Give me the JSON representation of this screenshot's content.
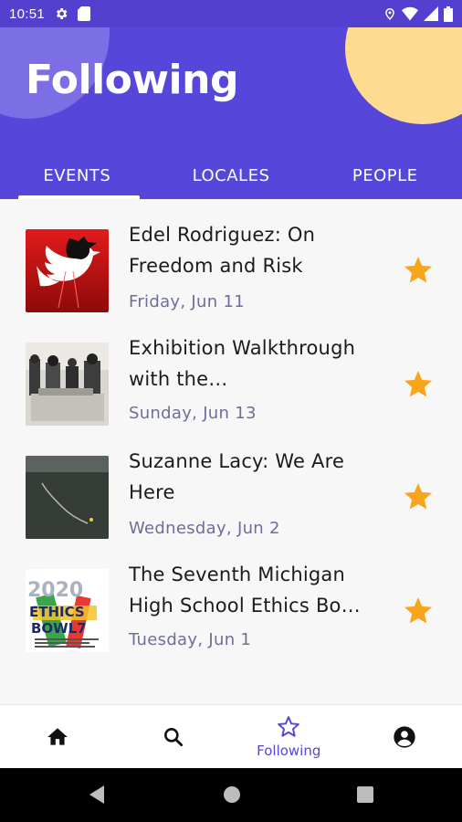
{
  "status_bar": {
    "time": "10:51",
    "icons": [
      "settings-icon",
      "sim-card-icon",
      "location-icon",
      "wifi-icon",
      "signal-icon",
      "battery-icon"
    ]
  },
  "header": {
    "title": "Following",
    "background_color": "#5646da",
    "accent_circle_color": "#fddc92",
    "tabs": [
      {
        "label": "EVENTS",
        "active": true
      },
      {
        "label": "LOCALES",
        "active": false
      },
      {
        "label": "PEOPLE",
        "active": false
      }
    ]
  },
  "events": [
    {
      "title": "Edel Rodriguez: On Freedom and Risk",
      "date": "Friday, Jun 11",
      "starred": true,
      "thumbnail": "red-bird-poster-image"
    },
    {
      "title": "Exhibition Walkthrough with the…",
      "date": "Sunday, Jun 13",
      "starred": true,
      "thumbnail": "gallery-visitors-photo"
    },
    {
      "title": "Suzanne Lacy: We Are Here",
      "date": "Wednesday, Jun 2",
      "starred": true,
      "thumbnail": "aerial-landscape-photo"
    },
    {
      "title": "The Seventh Michigan High School Ethics Bo…",
      "date": "Tuesday, Jun 1",
      "starred": true,
      "thumbnail": "ethics-bowl-logo-image"
    }
  ],
  "thumb_text": {
    "year": "2020",
    "line1": "ETHICS",
    "line2": "BOWL7"
  },
  "star_color": "#f8a51c",
  "bottom_nav": {
    "items": [
      {
        "icon": "home-icon",
        "label": ""
      },
      {
        "icon": "search-icon",
        "label": ""
      },
      {
        "icon": "star-outline-icon",
        "label": "Following",
        "active": true
      },
      {
        "icon": "account-circle-icon",
        "label": ""
      }
    ]
  },
  "system_nav": {
    "icons": [
      "back-icon",
      "home-circle-icon",
      "recents-icon"
    ]
  }
}
